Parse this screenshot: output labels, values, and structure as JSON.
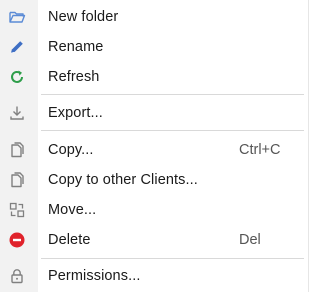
{
  "menu": {
    "items": [
      {
        "label": "New folder",
        "icon": "folder-open-icon",
        "shortcut": ""
      },
      {
        "label": "Rename",
        "icon": "pencil-icon",
        "shortcut": ""
      },
      {
        "label": "Refresh",
        "icon": "refresh-icon",
        "shortcut": ""
      },
      {
        "label": "Export...",
        "icon": "download-icon",
        "shortcut": ""
      },
      {
        "label": "Copy...",
        "icon": "copy-icon",
        "shortcut": "Ctrl+C"
      },
      {
        "label": "Copy to other Clients...",
        "icon": "copy-icon",
        "shortcut": ""
      },
      {
        "label": "Move...",
        "icon": "move-icon",
        "shortcut": ""
      },
      {
        "label": "Delete",
        "icon": "delete-icon",
        "shortcut": "Del"
      },
      {
        "label": "Permissions...",
        "icon": "lock-icon",
        "shortcut": ""
      }
    ]
  },
  "colors": {
    "folder_icon": "#5b8bd6",
    "pencil_icon": "#3f6fc4",
    "refresh_icon": "#2e9e4a",
    "delete_icon": "#e0222b",
    "gray_icon": "#808080"
  }
}
